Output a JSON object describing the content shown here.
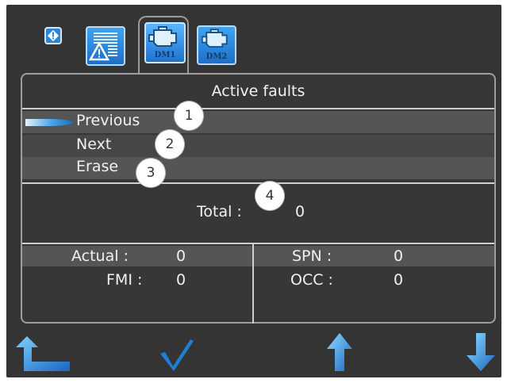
{
  "tabs": {
    "warning_icon": "warning-icon",
    "alarm_tab_icon": "alarm-list-icon",
    "dm1_label": "DM1",
    "dm2_label": "DM2",
    "engine_icon": "engine-icon"
  },
  "panel": {
    "title": "Active faults",
    "menu": [
      {
        "label": "Previous",
        "callout": "1"
      },
      {
        "label": "Next",
        "callout": "2"
      },
      {
        "label": "Erase",
        "callout": "3"
      }
    ],
    "total": {
      "label": "Total :",
      "value": "0",
      "callout": "4"
    },
    "stats": {
      "actual_label": "Actual :",
      "actual_value": "0",
      "fmi_label": "FMI :",
      "fmi_value": "0",
      "spn_label": "SPN :",
      "spn_value": "0",
      "occ_label": "OCC :",
      "occ_value": "0"
    }
  },
  "colors": {
    "accent": "#2a86d6",
    "check": "#1e7fd8",
    "background": "#343434"
  },
  "buttons": {
    "back_icon": "back-arrow-icon",
    "ok_icon": "checkmark-icon",
    "up_icon": "up-arrow-icon",
    "down_icon": "down-arrow-icon"
  }
}
